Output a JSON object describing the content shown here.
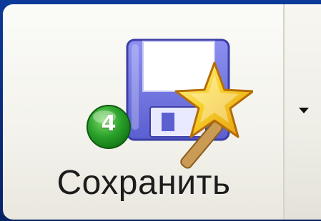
{
  "button": {
    "label": "Сохранить",
    "key_tip": "4"
  },
  "icons": {
    "main": "save-as-floppy-star-icon",
    "badge": "key-tip-badge",
    "dropdown": "chevron-down-icon"
  },
  "colors": {
    "background": "#0a2c7a",
    "button_face": "#f3f2ec",
    "floppy_body": "#7b7ee6",
    "floppy_shutter": "#ffffff",
    "star": "#f6c21a",
    "badge_green": "#2aa12a",
    "label_text": "#1c1c1c"
  }
}
